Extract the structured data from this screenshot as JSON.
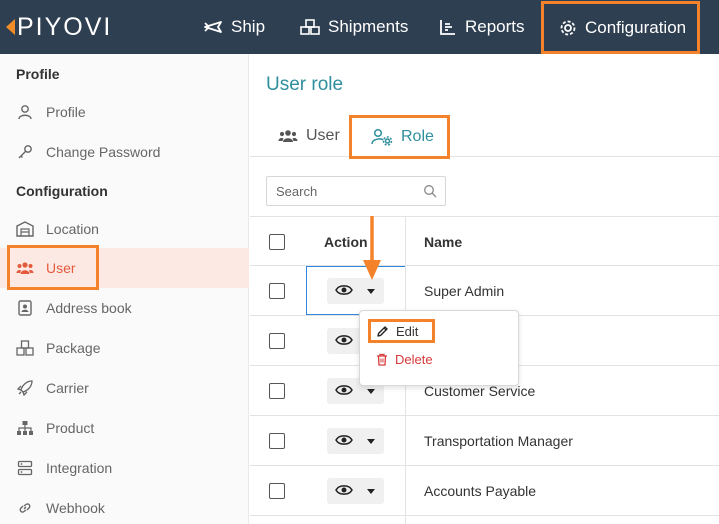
{
  "brand": {
    "name": "PIYOVI",
    "accent": "#f4822a",
    "nav_bg": "#2f3f52",
    "teal": "#2f8f9d"
  },
  "nav": {
    "ship": "Ship",
    "shipments": "Shipments",
    "reports": "Reports",
    "configuration": "Configuration"
  },
  "sidebar": {
    "section_profile": "Profile",
    "section_configuration": "Configuration",
    "items": [
      {
        "label": "Profile",
        "icon": "person-icon"
      },
      {
        "label": "Change Password",
        "icon": "key-icon"
      },
      {
        "label": "Location",
        "icon": "warehouse-icon"
      },
      {
        "label": "User",
        "icon": "users-icon",
        "active": true
      },
      {
        "label": "Address book",
        "icon": "address-book-icon"
      },
      {
        "label": "Package",
        "icon": "package-icon"
      },
      {
        "label": "Carrier",
        "icon": "rocket-icon"
      },
      {
        "label": "Product",
        "icon": "hierarchy-icon"
      },
      {
        "label": "Integration",
        "icon": "server-icon"
      },
      {
        "label": "Webhook",
        "icon": "link-icon"
      }
    ]
  },
  "main": {
    "title": "User role",
    "tabs": {
      "user": "User",
      "role": "Role"
    },
    "search": {
      "placeholder": "Search"
    },
    "table": {
      "headers": {
        "action": "Action",
        "name": "Name"
      },
      "rows": [
        "Super Admin",
        "",
        "Customer Service",
        "Transportation Manager",
        "Accounts Payable"
      ]
    },
    "menu": {
      "edit": "Edit",
      "delete": "Delete"
    }
  }
}
